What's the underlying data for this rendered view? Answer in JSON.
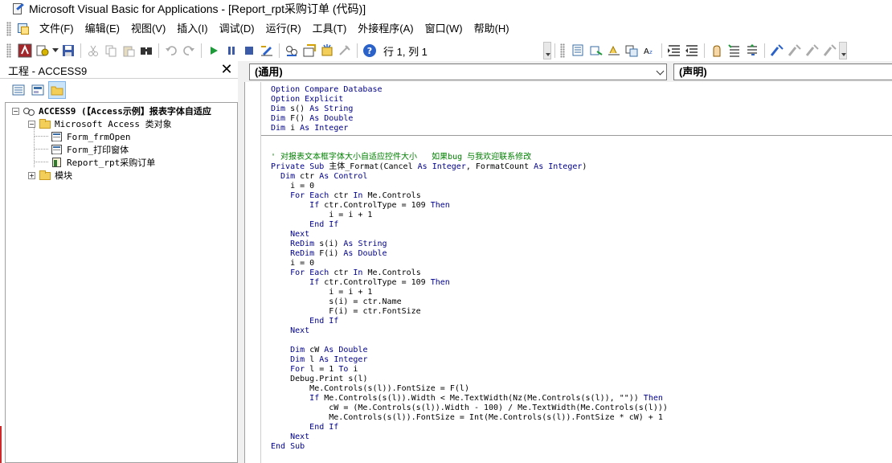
{
  "window": {
    "title": "Microsoft Visual Basic for Applications - [Report_rpt采购订单 (代码)]"
  },
  "menu": {
    "items": [
      "文件(F)",
      "编辑(E)",
      "视图(V)",
      "插入(I)",
      "调试(D)",
      "运行(R)",
      "工具(T)",
      "外接程序(A)",
      "窗口(W)",
      "帮助(H)"
    ]
  },
  "toolbar": {
    "position_text": "行 1, 列 1",
    "icons": [
      "access-view-icon",
      "insert-module-icon",
      "save-icon",
      "cut-icon",
      "copy-icon",
      "paste-icon",
      "find-icon",
      "undo-icon",
      "redo-icon",
      "run-icon",
      "break-icon",
      "reset-icon",
      "design-mode-icon",
      "project-explorer-icon",
      "properties-icon",
      "object-browser-icon",
      "toolbox-icon",
      "help-icon"
    ]
  },
  "project": {
    "title": "工程 - ACCESS9",
    "close": "✕",
    "tree": [
      {
        "text": "ACCESS9 (【Access示例】报表字体自适应",
        "level": 0,
        "expand": "−",
        "icon": "project-icon",
        "bold": true
      },
      {
        "text": "Microsoft Access 类对象",
        "level": 1,
        "expand": "−",
        "icon": "folder-icon"
      },
      {
        "text": "Form_frmOpen",
        "level": 2,
        "expand": "",
        "icon": "form-icon"
      },
      {
        "text": "Form_打印窗体",
        "level": 2,
        "expand": "",
        "icon": "form-icon"
      },
      {
        "text": "Report_rpt采购订单",
        "level": 2,
        "expand": "",
        "icon": "report-icon"
      },
      {
        "text": "模块",
        "level": 1,
        "expand": "+",
        "icon": "folder-icon"
      }
    ]
  },
  "code": {
    "object_combo": "(通用)",
    "proc_combo": "(声明)",
    "declarations": [
      "Option Compare Database",
      "Option Explicit",
      "Dim s() As String",
      "Dim F() As Double",
      "Dim i As Integer"
    ],
    "lines": [
      "",
      "",
      "' 对报表文本框字体大小自适应控件大小   如果bug 与我欢迎联系修改",
      "Private Sub 主体_Format(Cancel As Integer, FormatCount As Integer)",
      "  Dim ctr As Control",
      "    i = 0",
      "    For Each ctr In Me.Controls",
      "        If ctr.ControlType = 109 Then",
      "            i = i + 1",
      "        End If",
      "    Next",
      "    ReDim s(i) As String",
      "    ReDim F(i) As Double",
      "    i = 0",
      "    For Each ctr In Me.Controls",
      "        If ctr.ControlType = 109 Then",
      "            i = i + 1",
      "            s(i) = ctr.Name",
      "            F(i) = ctr.FontSize",
      "        End If",
      "    Next",
      "",
      "    Dim cW As Double",
      "    Dim l As Integer",
      "    For l = 1 To i",
      "    Debug.Print s(l)",
      "        Me.Controls(s(l)).FontSize = F(l)",
      "        If Me.Controls(s(l)).Width < Me.TextWidth(Nz(Me.Controls(s(l)), \"\")) Then",
      "            cW = (Me.Controls(s(l)).Width - 100) / Me.TextWidth(Me.Controls(s(l)))",
      "            Me.Controls(s(l)).FontSize = Int(Me.Controls(s(l)).FontSize * cW) + 1",
      "        End If",
      "    Next",
      "End Sub"
    ]
  }
}
